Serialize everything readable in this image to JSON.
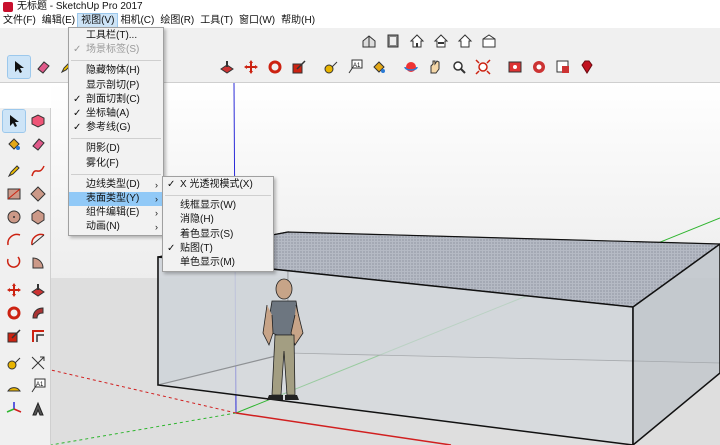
{
  "window": {
    "title": "无标题 - SketchUp Pro 2017",
    "app_icon": "sketchup-logo-icon",
    "accent": "#c8102e"
  },
  "menubar": {
    "items": [
      {
        "label": "文件(F)"
      },
      {
        "label": "编辑(E)"
      },
      {
        "label": "视图(V)"
      },
      {
        "label": "相机(C)"
      },
      {
        "label": "绘图(R)"
      },
      {
        "label": "工具(T)"
      },
      {
        "label": "窗口(W)"
      },
      {
        "label": "帮助(H)"
      }
    ],
    "active_index": 2
  },
  "view_menu": {
    "items": [
      {
        "label": "工具栏(T)...",
        "checked": false,
        "submenu": false,
        "disabled": false
      },
      {
        "label": "场景标签(S)",
        "checked": true,
        "submenu": false,
        "disabled": true
      },
      {
        "label": "隐藏物体(H)",
        "checked": false,
        "submenu": false,
        "disabled": false
      },
      {
        "label": "显示剖切(P)",
        "checked": false,
        "submenu": false,
        "disabled": false
      },
      {
        "label": "剖面切割(C)",
        "checked": true,
        "submenu": false,
        "disabled": false
      },
      {
        "label": "坐标轴(A)",
        "checked": true,
        "submenu": false,
        "disabled": false
      },
      {
        "label": "参考线(G)",
        "checked": true,
        "submenu": false,
        "disabled": false
      },
      {
        "label": "阴影(D)",
        "checked": false,
        "submenu": false,
        "disabled": false
      },
      {
        "label": "雾化(F)",
        "checked": false,
        "submenu": false,
        "disabled": false
      },
      {
        "label": "边线类型(D)",
        "checked": false,
        "submenu": true,
        "disabled": false
      },
      {
        "label": "表面类型(Y)",
        "checked": false,
        "submenu": true,
        "disabled": false,
        "highlighted": true
      },
      {
        "label": "组件编辑(E)",
        "checked": false,
        "submenu": true,
        "disabled": false
      },
      {
        "label": "动画(N)",
        "checked": false,
        "submenu": true,
        "disabled": false
      }
    ]
  },
  "face_style_submenu": {
    "items": [
      {
        "label": "X 光透视模式(X)",
        "checked": true
      },
      {
        "label": "线框显示(W)",
        "checked": false
      },
      {
        "label": "消隐(H)",
        "checked": false
      },
      {
        "label": "着色显示(S)",
        "checked": false
      },
      {
        "label": "贴图(T)",
        "checked": true
      },
      {
        "label": "单色显示(M)",
        "checked": false
      }
    ]
  },
  "toolbar": {
    "views_icons": [
      "iso-view-icon",
      "top-view-icon",
      "front-view-icon",
      "right-view-icon",
      "back-view-icon",
      "left-view-icon"
    ],
    "main_icons": [
      "select-icon",
      "eraser-icon",
      "pencil-icon",
      "rotate-icon",
      "move-icon",
      "orbit-icon",
      "scale-icon",
      "tape-measure-icon",
      "text-icon",
      "paint-bucket-icon",
      "orbit-view-icon",
      "pan-icon",
      "zoom-icon",
      "zoom-extents-icon",
      "add-location-icon",
      "3d-warehouse-icon",
      "extension-warehouse-icon",
      "ruby-icon"
    ],
    "selected_icon": "select-icon"
  },
  "left_toolbar": {
    "icons": [
      "select-icon",
      "make-component-icon",
      "paint-bucket-icon",
      "eraser-icon",
      "line-icon",
      "freehand-icon",
      "rectangle-icon",
      "rotated-rectangle-icon",
      "circle-icon",
      "polygon-icon",
      "arc-icon",
      "two-point-arc-icon",
      "three-point-arc-icon",
      "pie-icon",
      "move-icon",
      "push-pull-icon",
      "rotate-icon",
      "follow-me-icon",
      "scale-icon",
      "offset-icon",
      "tape-measure-icon",
      "dimension-icon",
      "protractor-icon",
      "text-icon",
      "axes-icon",
      "3d-text-icon"
    ],
    "selected_icon": "select-icon"
  },
  "colors": {
    "axis_red": "#d11f1f",
    "axis_green": "#2fb52f",
    "axis_blue": "#2b2bd8",
    "box_edge": "#111111",
    "box_face": "#c8cdd1",
    "box_top": "#aeb3bd",
    "ground": "#dedede",
    "menu_highlight": "#91c9f7"
  },
  "model": {
    "figure": "scale-figure-person"
  }
}
